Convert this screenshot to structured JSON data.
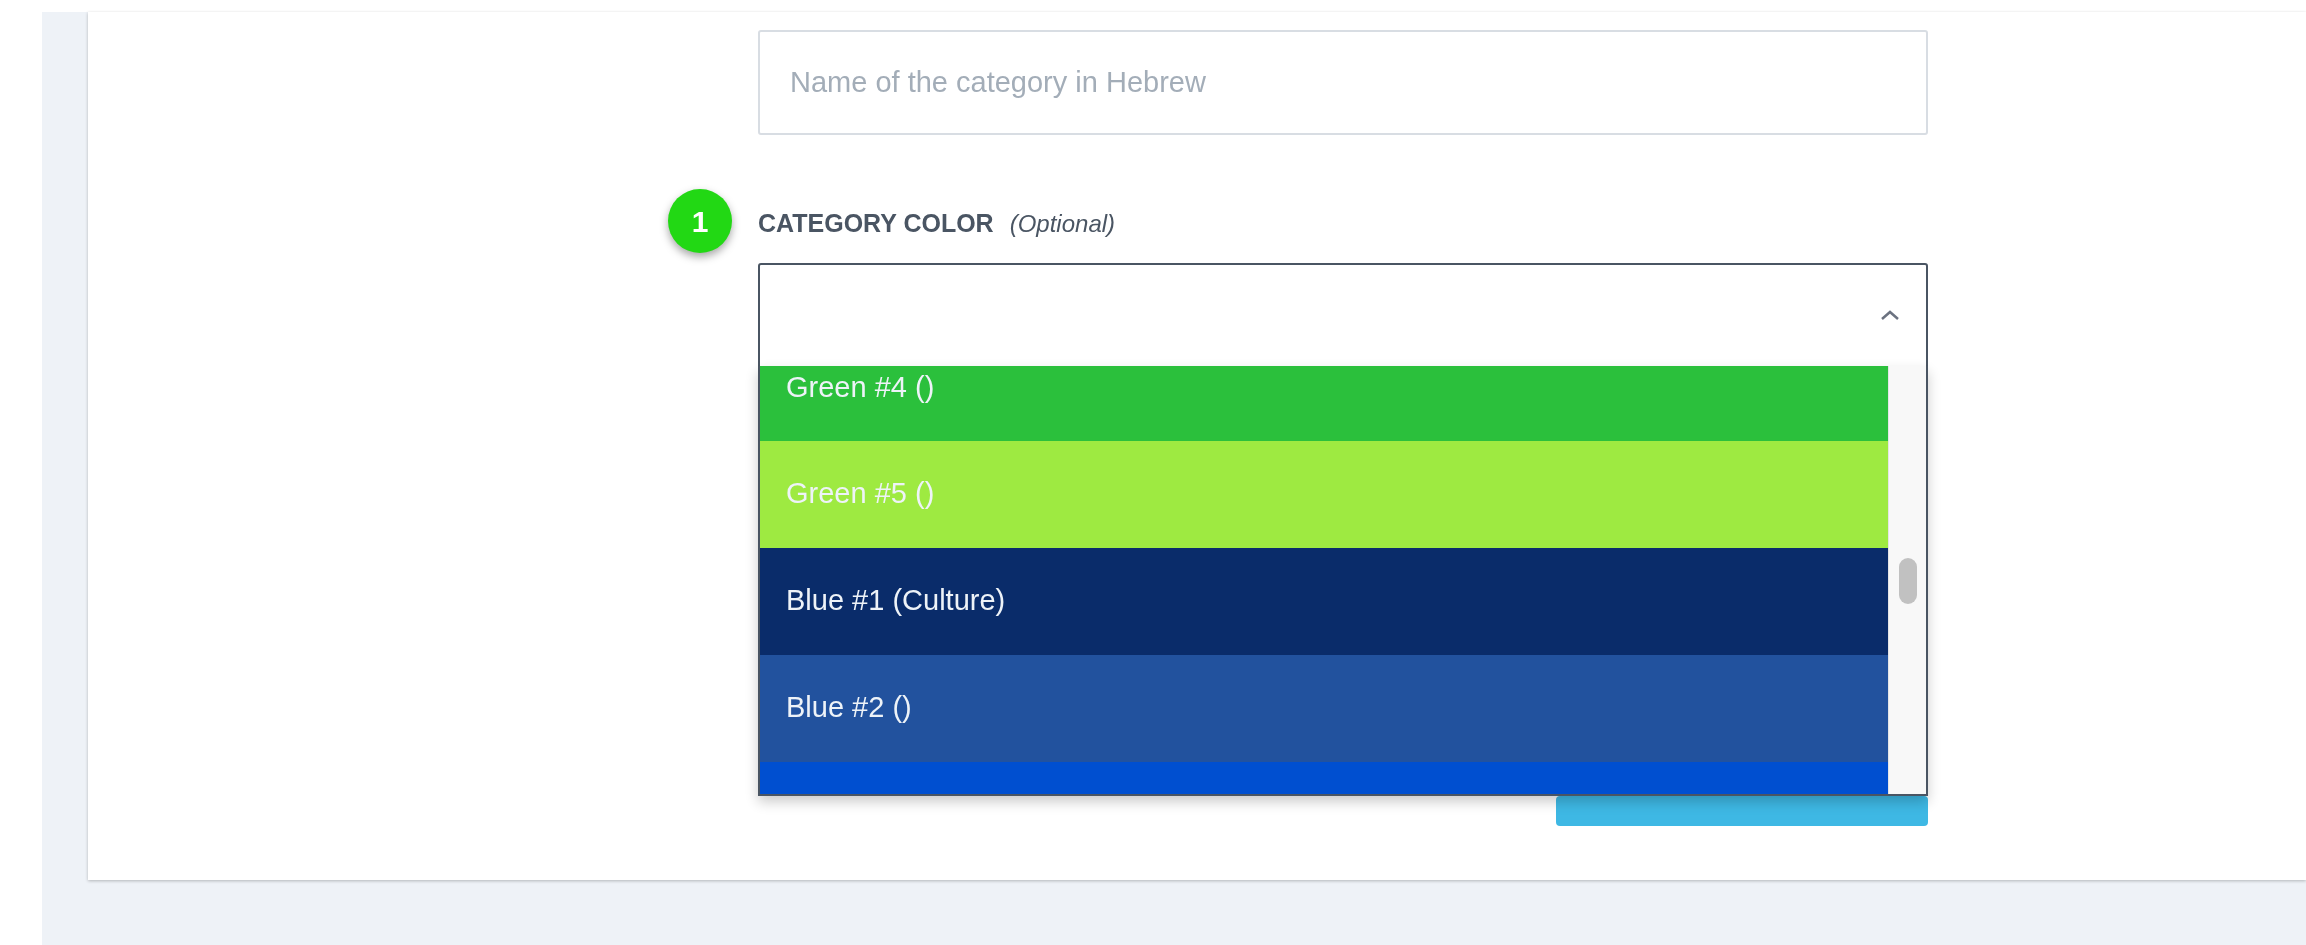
{
  "name_field": {
    "placeholder": "Name of the category in Hebrew"
  },
  "color_field": {
    "label": "CATEGORY COLOR",
    "hint": "(Optional)",
    "expanded": true,
    "options": [
      {
        "label": "Green #4 ()",
        "color": "#2bc03c"
      },
      {
        "label": "Green #5 ()",
        "color": "#9eea41"
      },
      {
        "label": "Blue #1 (Culture)",
        "color": "#0a2c6a"
      },
      {
        "label": "Blue #2 ()",
        "color": "#22529e"
      },
      {
        "color": "#004fd0"
      }
    ]
  },
  "annotation_badge": "1"
}
